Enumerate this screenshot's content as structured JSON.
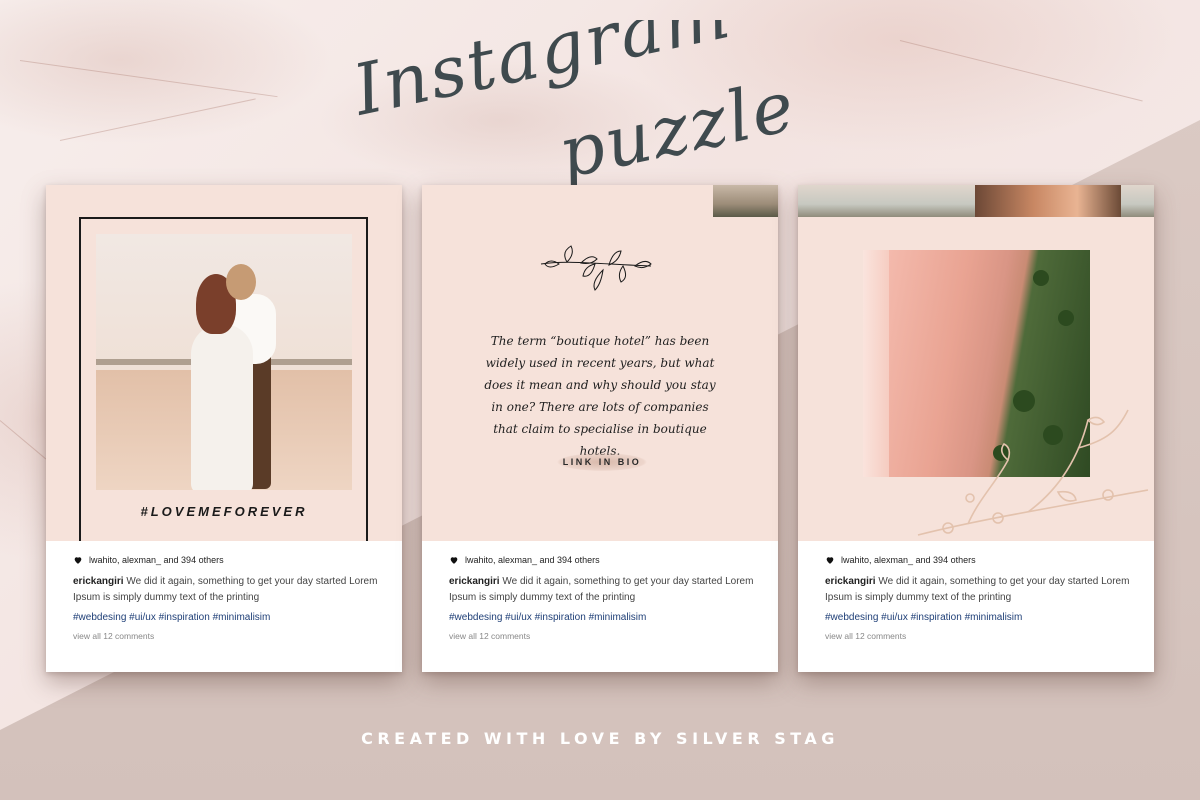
{
  "title": {
    "line1": "Instagram",
    "line2": "puzzle"
  },
  "cards": [
    {
      "hashtag_title": "#LOVEMEFOREVER",
      "likes": "lwahito, alexman_ and 394 others",
      "username": "erickangiri",
      "caption": " We did it again,  something to get your day started Lorem Ipsum is simply dummy text of the printing",
      "tags": [
        "#webdesing",
        "#ui/ux",
        "#inspiration",
        "#minimalisim"
      ],
      "comments": "view all 12 comments"
    },
    {
      "quote": "The term “boutique hotel” has been widely used in recent years, but what does it mean and why should you stay in one? There are lots of companies that claim to specialise in boutique hotels.",
      "link_label": "LINK IN BIO",
      "likes": "lwahito, alexman_ and 394 others",
      "username": "erickangiri",
      "caption": " We did it again,  something to get your day started Lorem Ipsum is simply dummy text of the printing",
      "tags": [
        "#webdesing",
        "#ui/ux",
        "#inspiration",
        "#minimalisim"
      ],
      "comments": "view all 12 comments"
    },
    {
      "likes": "lwahito, alexman_ and 394 others",
      "username": "erickangiri",
      "caption": " We did it again,  something to get your day started Lorem Ipsum is simply dummy text of the printing",
      "tags": [
        "#webdesing",
        "#ui/ux",
        "#inspiration",
        "#minimalisim"
      ],
      "comments": "view all 12 comments"
    }
  ],
  "footer": "CREATED WITH LOVE BY SILVER STAG",
  "icons": {
    "like": "heart-icon",
    "ornament": "branch-icon",
    "floral": "floral-branch-icon"
  },
  "colors": {
    "panel": "#f6e2da",
    "hashtag": "#1f3f77",
    "title_ink": "#3f4a4e"
  }
}
